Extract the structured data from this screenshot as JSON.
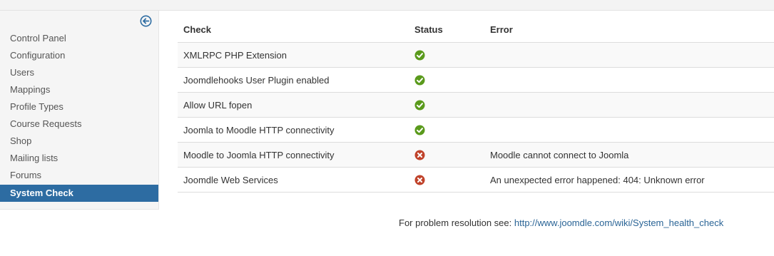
{
  "sidebar": {
    "toggle_icon": "arrow-circle-left-icon",
    "items": [
      {
        "label": "Control Panel"
      },
      {
        "label": "Configuration"
      },
      {
        "label": "Users"
      },
      {
        "label": "Mappings"
      },
      {
        "label": "Profile Types"
      },
      {
        "label": "Course Requests"
      },
      {
        "label": "Shop"
      },
      {
        "label": "Mailing lists"
      },
      {
        "label": "Forums"
      },
      {
        "label": "System Check",
        "active": true
      }
    ]
  },
  "table": {
    "headers": {
      "check": "Check",
      "status": "Status",
      "error": "Error"
    },
    "rows": [
      {
        "check": "XMLRPC PHP Extension",
        "status": "ok",
        "error": ""
      },
      {
        "check": "Joomdlehooks User Plugin enabled",
        "status": "ok",
        "error": ""
      },
      {
        "check": "Allow URL fopen",
        "status": "ok",
        "error": ""
      },
      {
        "check": "Joomla to Moodle HTTP connectivity",
        "status": "ok",
        "error": ""
      },
      {
        "check": "Moodle to Joomla HTTP connectivity",
        "status": "error",
        "error": "Moodle cannot connect to Joomla"
      },
      {
        "check": "Joomdle Web Services",
        "status": "error",
        "error": "An unexpected error happened: 404: Unknown error"
      }
    ]
  },
  "footer": {
    "text": "For problem resolution see:",
    "link": "http://www.joomdle.com/wiki/System_health_check"
  },
  "colors": {
    "accent": "#2d6ca2",
    "ok": "#5a9a1c",
    "error": "#c0432b"
  }
}
